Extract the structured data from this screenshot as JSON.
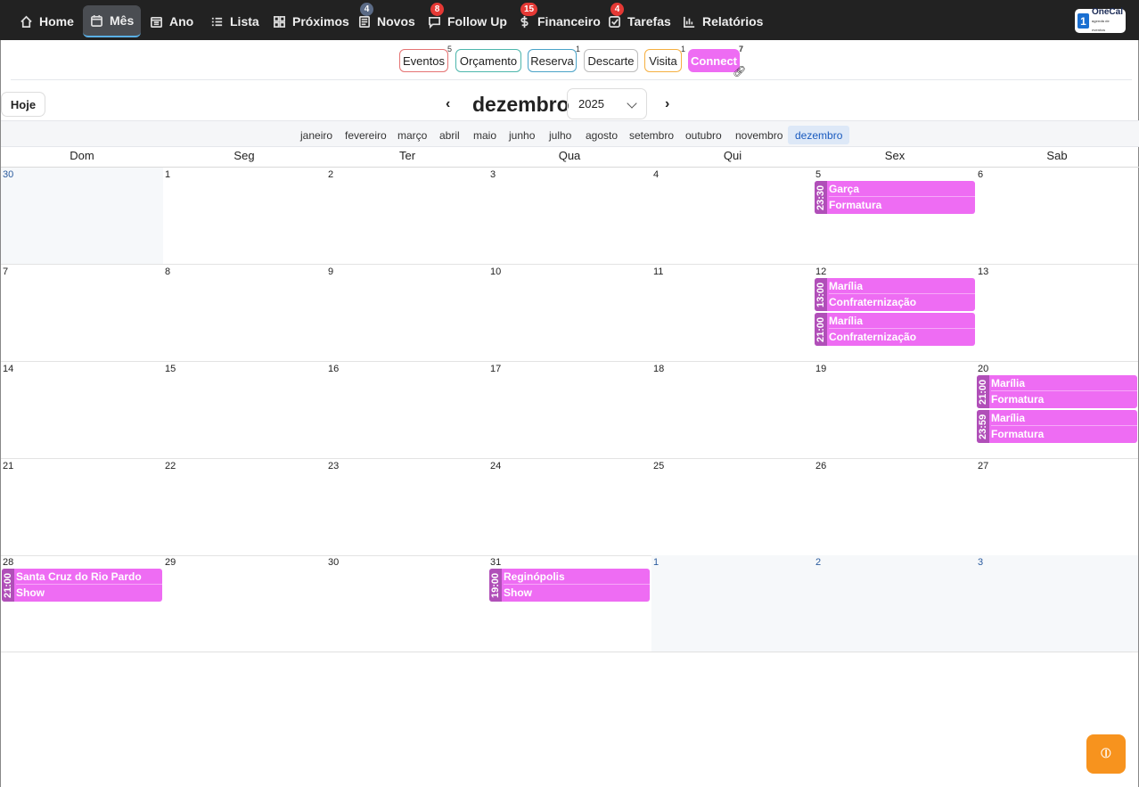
{
  "nav": {
    "items": [
      {
        "label": "Home",
        "icon": "home-icon"
      },
      {
        "label": "Mês",
        "icon": "calendar-icon",
        "active": true
      },
      {
        "label": "Ano",
        "icon": "year-calendar-icon"
      },
      {
        "label": "Lista",
        "icon": "list-icon"
      },
      {
        "label": "Próximos",
        "icon": "grid-icon"
      },
      {
        "label": "Novos",
        "icon": "newspaper-icon",
        "badge": "4",
        "badge_color": "#5b6b86"
      },
      {
        "label": "Follow Up",
        "icon": "chat-icon",
        "badge": "8",
        "badge_color": "#e53935"
      },
      {
        "label": "Financeiro",
        "icon": "dollar-icon",
        "badge": "15",
        "badge_color": "#e53935"
      },
      {
        "label": "Tarefas",
        "icon": "checkbox-icon",
        "badge": "4",
        "badge_color": "#e53935"
      },
      {
        "label": "Relatórios",
        "icon": "bar-chart-icon"
      }
    ],
    "logo": {
      "number": "1",
      "name": "OneCal",
      "tagline": "agenda de eventos"
    }
  },
  "filters": [
    {
      "label": "Eventos",
      "count": "5",
      "color": "#e57373"
    },
    {
      "label": "Orçamento",
      "count": "",
      "color": "#4db6ac"
    },
    {
      "label": "Reserva",
      "count": "1",
      "color": "#4aa3c8"
    },
    {
      "label": "Descarte",
      "count": "",
      "color": "#bdbdbd"
    },
    {
      "label": "Visita",
      "count": "1",
      "color": "#f5b041"
    },
    {
      "label": "Connect",
      "count": "7",
      "color": "#ee6cf3"
    }
  ],
  "toolbar": {
    "today": "Hoje",
    "month": "dezembro",
    "year": "2025",
    "prev": "‹",
    "next": "›"
  },
  "months": [
    "janeiro",
    "fevereiro",
    "março",
    "abril",
    "maio",
    "junho",
    "julho",
    "agosto",
    "setembro",
    "outubro",
    "novembro",
    "dezembro"
  ],
  "selected_month": 11,
  "weekdays": [
    "Dom",
    "Seg",
    "Ter",
    "Qua",
    "Qui",
    "Sex",
    "Sab"
  ],
  "weeks": [
    [
      {
        "d": "30",
        "out": true
      },
      {
        "d": "1"
      },
      {
        "d": "2"
      },
      {
        "d": "3"
      },
      {
        "d": "4"
      },
      {
        "d": "5",
        "events": [
          {
            "time": "23:30",
            "title": "Garça",
            "type": "Formatura"
          }
        ]
      },
      {
        "d": "6"
      }
    ],
    [
      {
        "d": "7"
      },
      {
        "d": "8"
      },
      {
        "d": "9"
      },
      {
        "d": "10"
      },
      {
        "d": "11"
      },
      {
        "d": "12",
        "events": [
          {
            "time": "13:00",
            "title": "Marília",
            "type": "Confraternização"
          },
          {
            "time": "21:00",
            "title": "Marília",
            "type": "Confraternização"
          }
        ]
      },
      {
        "d": "13"
      }
    ],
    [
      {
        "d": "14"
      },
      {
        "d": "15"
      },
      {
        "d": "16"
      },
      {
        "d": "17"
      },
      {
        "d": "18"
      },
      {
        "d": "19"
      },
      {
        "d": "20",
        "events": [
          {
            "time": "21:00",
            "title": "Marília",
            "type": "Formatura"
          },
          {
            "time": "23:59",
            "title": "Marília",
            "type": "Formatura"
          }
        ]
      }
    ],
    [
      {
        "d": "21"
      },
      {
        "d": "22"
      },
      {
        "d": "23"
      },
      {
        "d": "24"
      },
      {
        "d": "25"
      },
      {
        "d": "26"
      },
      {
        "d": "27"
      }
    ],
    [
      {
        "d": "28",
        "events": [
          {
            "time": "21:00",
            "title": "Santa Cruz do Rio Pardo",
            "type": "Show"
          }
        ]
      },
      {
        "d": "29"
      },
      {
        "d": "30"
      },
      {
        "d": "31",
        "events": [
          {
            "time": "19:00",
            "title": "Reginópolis",
            "type": "Show"
          }
        ]
      },
      {
        "d": "1",
        "out": true
      },
      {
        "d": "2",
        "out": true
      },
      {
        "d": "3",
        "out": true
      }
    ]
  ],
  "fab": {
    "icon": "ticket-icon"
  }
}
